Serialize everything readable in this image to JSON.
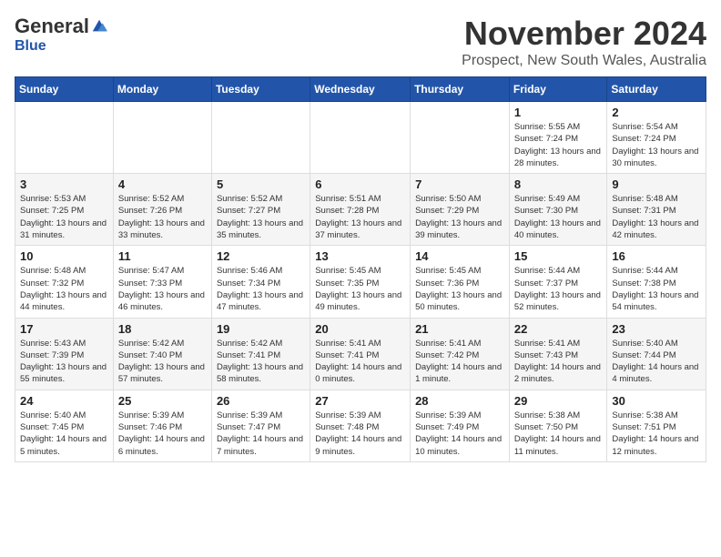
{
  "logo": {
    "general": "General",
    "blue": "Blue"
  },
  "title": "November 2024",
  "location": "Prospect, New South Wales, Australia",
  "days_of_week": [
    "Sunday",
    "Monday",
    "Tuesday",
    "Wednesday",
    "Thursday",
    "Friday",
    "Saturday"
  ],
  "weeks": [
    [
      {
        "day": "",
        "sunrise": "",
        "sunset": "",
        "daylight": ""
      },
      {
        "day": "",
        "sunrise": "",
        "sunset": "",
        "daylight": ""
      },
      {
        "day": "",
        "sunrise": "",
        "sunset": "",
        "daylight": ""
      },
      {
        "day": "",
        "sunrise": "",
        "sunset": "",
        "daylight": ""
      },
      {
        "day": "",
        "sunrise": "",
        "sunset": "",
        "daylight": ""
      },
      {
        "day": "1",
        "sunrise": "Sunrise: 5:55 AM",
        "sunset": "Sunset: 7:24 PM",
        "daylight": "Daylight: 13 hours and 28 minutes."
      },
      {
        "day": "2",
        "sunrise": "Sunrise: 5:54 AM",
        "sunset": "Sunset: 7:24 PM",
        "daylight": "Daylight: 13 hours and 30 minutes."
      }
    ],
    [
      {
        "day": "3",
        "sunrise": "Sunrise: 5:53 AM",
        "sunset": "Sunset: 7:25 PM",
        "daylight": "Daylight: 13 hours and 31 minutes."
      },
      {
        "day": "4",
        "sunrise": "Sunrise: 5:52 AM",
        "sunset": "Sunset: 7:26 PM",
        "daylight": "Daylight: 13 hours and 33 minutes."
      },
      {
        "day": "5",
        "sunrise": "Sunrise: 5:52 AM",
        "sunset": "Sunset: 7:27 PM",
        "daylight": "Daylight: 13 hours and 35 minutes."
      },
      {
        "day": "6",
        "sunrise": "Sunrise: 5:51 AM",
        "sunset": "Sunset: 7:28 PM",
        "daylight": "Daylight: 13 hours and 37 minutes."
      },
      {
        "day": "7",
        "sunrise": "Sunrise: 5:50 AM",
        "sunset": "Sunset: 7:29 PM",
        "daylight": "Daylight: 13 hours and 39 minutes."
      },
      {
        "day": "8",
        "sunrise": "Sunrise: 5:49 AM",
        "sunset": "Sunset: 7:30 PM",
        "daylight": "Daylight: 13 hours and 40 minutes."
      },
      {
        "day": "9",
        "sunrise": "Sunrise: 5:48 AM",
        "sunset": "Sunset: 7:31 PM",
        "daylight": "Daylight: 13 hours and 42 minutes."
      }
    ],
    [
      {
        "day": "10",
        "sunrise": "Sunrise: 5:48 AM",
        "sunset": "Sunset: 7:32 PM",
        "daylight": "Daylight: 13 hours and 44 minutes."
      },
      {
        "day": "11",
        "sunrise": "Sunrise: 5:47 AM",
        "sunset": "Sunset: 7:33 PM",
        "daylight": "Daylight: 13 hours and 46 minutes."
      },
      {
        "day": "12",
        "sunrise": "Sunrise: 5:46 AM",
        "sunset": "Sunset: 7:34 PM",
        "daylight": "Daylight: 13 hours and 47 minutes."
      },
      {
        "day": "13",
        "sunrise": "Sunrise: 5:45 AM",
        "sunset": "Sunset: 7:35 PM",
        "daylight": "Daylight: 13 hours and 49 minutes."
      },
      {
        "day": "14",
        "sunrise": "Sunrise: 5:45 AM",
        "sunset": "Sunset: 7:36 PM",
        "daylight": "Daylight: 13 hours and 50 minutes."
      },
      {
        "day": "15",
        "sunrise": "Sunrise: 5:44 AM",
        "sunset": "Sunset: 7:37 PM",
        "daylight": "Daylight: 13 hours and 52 minutes."
      },
      {
        "day": "16",
        "sunrise": "Sunrise: 5:44 AM",
        "sunset": "Sunset: 7:38 PM",
        "daylight": "Daylight: 13 hours and 54 minutes."
      }
    ],
    [
      {
        "day": "17",
        "sunrise": "Sunrise: 5:43 AM",
        "sunset": "Sunset: 7:39 PM",
        "daylight": "Daylight: 13 hours and 55 minutes."
      },
      {
        "day": "18",
        "sunrise": "Sunrise: 5:42 AM",
        "sunset": "Sunset: 7:40 PM",
        "daylight": "Daylight: 13 hours and 57 minutes."
      },
      {
        "day": "19",
        "sunrise": "Sunrise: 5:42 AM",
        "sunset": "Sunset: 7:41 PM",
        "daylight": "Daylight: 13 hours and 58 minutes."
      },
      {
        "day": "20",
        "sunrise": "Sunrise: 5:41 AM",
        "sunset": "Sunset: 7:41 PM",
        "daylight": "Daylight: 14 hours and 0 minutes."
      },
      {
        "day": "21",
        "sunrise": "Sunrise: 5:41 AM",
        "sunset": "Sunset: 7:42 PM",
        "daylight": "Daylight: 14 hours and 1 minute."
      },
      {
        "day": "22",
        "sunrise": "Sunrise: 5:41 AM",
        "sunset": "Sunset: 7:43 PM",
        "daylight": "Daylight: 14 hours and 2 minutes."
      },
      {
        "day": "23",
        "sunrise": "Sunrise: 5:40 AM",
        "sunset": "Sunset: 7:44 PM",
        "daylight": "Daylight: 14 hours and 4 minutes."
      }
    ],
    [
      {
        "day": "24",
        "sunrise": "Sunrise: 5:40 AM",
        "sunset": "Sunset: 7:45 PM",
        "daylight": "Daylight: 14 hours and 5 minutes."
      },
      {
        "day": "25",
        "sunrise": "Sunrise: 5:39 AM",
        "sunset": "Sunset: 7:46 PM",
        "daylight": "Daylight: 14 hours and 6 minutes."
      },
      {
        "day": "26",
        "sunrise": "Sunrise: 5:39 AM",
        "sunset": "Sunset: 7:47 PM",
        "daylight": "Daylight: 14 hours and 7 minutes."
      },
      {
        "day": "27",
        "sunrise": "Sunrise: 5:39 AM",
        "sunset": "Sunset: 7:48 PM",
        "daylight": "Daylight: 14 hours and 9 minutes."
      },
      {
        "day": "28",
        "sunrise": "Sunrise: 5:39 AM",
        "sunset": "Sunset: 7:49 PM",
        "daylight": "Daylight: 14 hours and 10 minutes."
      },
      {
        "day": "29",
        "sunrise": "Sunrise: 5:38 AM",
        "sunset": "Sunset: 7:50 PM",
        "daylight": "Daylight: 14 hours and 11 minutes."
      },
      {
        "day": "30",
        "sunrise": "Sunrise: 5:38 AM",
        "sunset": "Sunset: 7:51 PM",
        "daylight": "Daylight: 14 hours and 12 minutes."
      }
    ]
  ]
}
